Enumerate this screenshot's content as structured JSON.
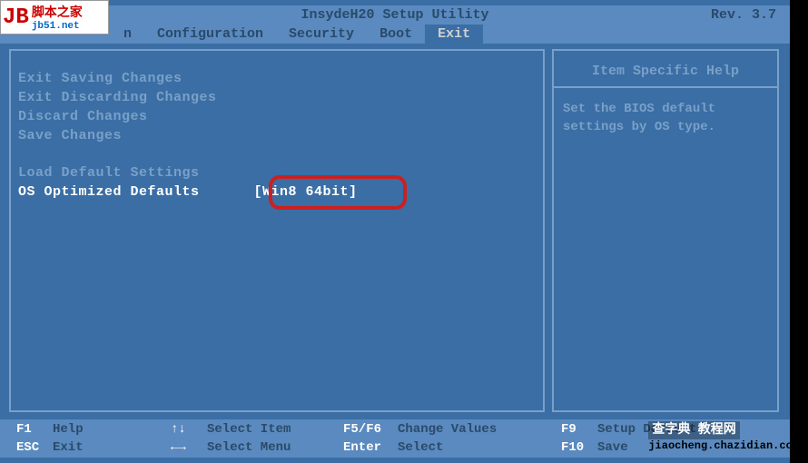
{
  "watermark": {
    "logo_initials": "JB",
    "logo_cn": "脚本之家",
    "logo_url": "jb51.net",
    "bottom_cn": "查字典 教程网",
    "bottom_en": "jiaocheng.chazidian.com"
  },
  "header": {
    "title": "InsydeH20 Setup Utility",
    "revision": "Rev. 3.7"
  },
  "menu_tabs": [
    {
      "label": "n",
      "active": false
    },
    {
      "label": "Configuration",
      "active": false
    },
    {
      "label": "Security",
      "active": false
    },
    {
      "label": "Boot",
      "active": false
    },
    {
      "label": "Exit",
      "active": true
    }
  ],
  "exit_menu": {
    "items": [
      {
        "label": "Exit Saving Changes",
        "selected": false
      },
      {
        "label": "Exit Discarding Changes",
        "selected": false
      },
      {
        "label": "Discard Changes",
        "selected": false
      },
      {
        "label": "Save Changes",
        "selected": false
      }
    ],
    "items2": [
      {
        "label": "Load Default Settings",
        "selected": false
      }
    ],
    "selected_item": {
      "label": "OS Optimized Defaults",
      "value": "[Win8 64bit]"
    }
  },
  "help": {
    "title": "Item Specific Help",
    "text": "Set the BIOS default settings by OS type."
  },
  "footer": {
    "row1": [
      {
        "key": "F1",
        "action": "Help"
      },
      {
        "key": "↑↓",
        "action": "Select Item"
      },
      {
        "key": "F5/F6",
        "action": "Change Values"
      },
      {
        "key": "F9",
        "action": "Setup Default"
      }
    ],
    "row2": [
      {
        "key": "ESC",
        "action": "Exit"
      },
      {
        "key": "←→",
        "action": "Select Menu"
      },
      {
        "key": "Enter",
        "action": "Select"
      },
      {
        "key": "F10",
        "action": "Save"
      }
    ]
  }
}
